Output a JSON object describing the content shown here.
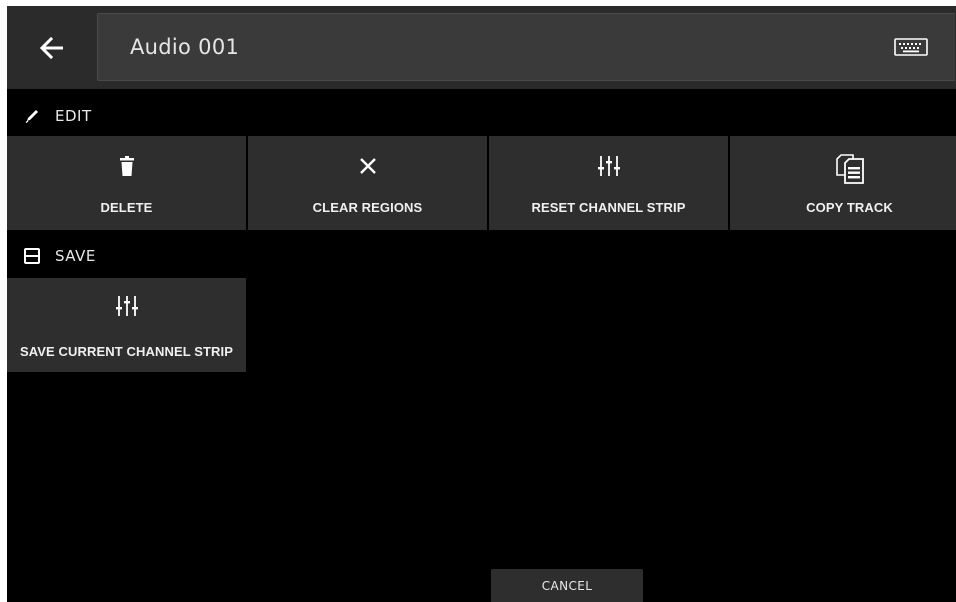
{
  "header": {
    "back_icon": "arrow-left-icon",
    "title": "Audio 001",
    "keyboard_icon": "keyboard-icon"
  },
  "sections": {
    "edit": {
      "label": "EDIT",
      "icon": "pencil-icon",
      "buttons": [
        {
          "label": "DELETE",
          "icon": "trash-icon"
        },
        {
          "label": "CLEAR REGIONS",
          "icon": "close-icon"
        },
        {
          "label": "RESET CHANNEL STRIP",
          "icon": "sliders-icon"
        },
        {
          "label": "COPY TRACK",
          "icon": "copy-documents-icon"
        }
      ]
    },
    "save": {
      "label": "SAVE",
      "icon": "floppy-disk-icon",
      "buttons": [
        {
          "label": "SAVE CURRENT CHANNEL STRIP",
          "icon": "sliders-icon"
        }
      ]
    }
  },
  "footer": {
    "cancel_label": "CANCEL"
  },
  "colors": {
    "background": "#000000",
    "header": "#2b2b2b",
    "field": "#3a3a3a",
    "tile": "#2e2e2e",
    "text": "#ffffff"
  }
}
